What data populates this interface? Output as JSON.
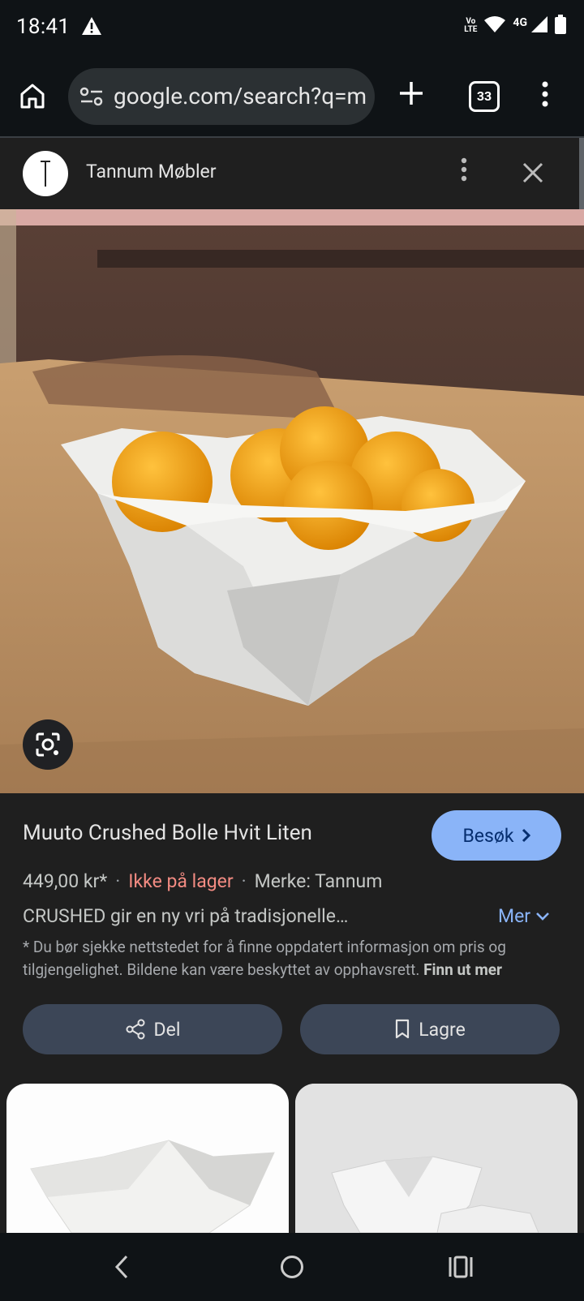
{
  "status": {
    "time": "18:41",
    "volte_top": "Vo",
    "volte_bottom": "LTE",
    "network": "4G"
  },
  "browser": {
    "url": "google.com/search?q=m",
    "tab_count": "33"
  },
  "panel": {
    "source": "Tannum Møbler"
  },
  "product": {
    "title": "Muuto Crushed Bolle Hvit Liten",
    "visit_label": "Besøk",
    "price": "449,00 kr*",
    "stock": "Ikke på lager",
    "brand": "Merke: Tannum",
    "description": "CRUSHED gir en ny vri på tradisjonelle…",
    "more_label": "Mer",
    "disclaimer": "* Du bør sjekke nettstedet for å finne oppdatert informasjon om pris og tilgjengelighet. Bildene kan være beskyttet av opphavsrett.",
    "learn_more": "Finn ut mer"
  },
  "actions": {
    "share_label": "Del",
    "save_label": "Lagre"
  },
  "colors": {
    "accent": "#8ab4f8",
    "out_of_stock": "#f28b82",
    "button_bg": "#3c4657"
  }
}
